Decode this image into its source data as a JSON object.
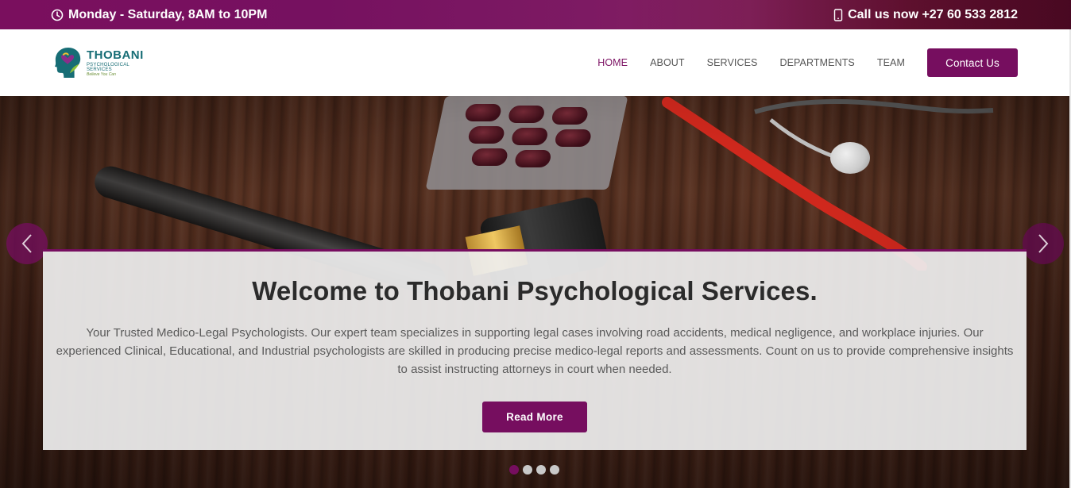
{
  "topbar": {
    "hours": "Monday - Saturday, 8AM to 10PM",
    "phone": "Call us now +27 60 533 2812",
    "hours_icon": "clock-icon",
    "phone_icon": "mobile-phone-icon"
  },
  "logo": {
    "title": "THOBANI",
    "subtitle": "PSYCHOLOGICAL SERVICES",
    "tagline": "Believe You Can"
  },
  "nav": {
    "items": [
      {
        "label": "HOME",
        "active": true
      },
      {
        "label": "ABOUT",
        "active": false
      },
      {
        "label": "SERVICES",
        "active": false
      },
      {
        "label": "DEPARTMENTS",
        "active": false
      },
      {
        "label": "TEAM",
        "active": false
      }
    ],
    "contact_label": "Contact Us"
  },
  "hero": {
    "heading": "Welcome to Thobani Psychological Services.",
    "body": "Your Trusted Medico-Legal Psychologists. Our expert team specializes in supporting legal cases involving road accidents, medical negligence, and workplace injuries. Our experienced Clinical, Educational, and Industrial psychologists are skilled in producing precise medico-legal reports and assessments. Count on us to provide comprehensive insights to assist instructing attorneys in court when needed.",
    "button_label": "Read More",
    "slide_count": 4,
    "active_slide": 1
  },
  "colors": {
    "brand": "#760e5f",
    "logo_teal": "#176d75",
    "text_dark": "#2b2b2b"
  }
}
